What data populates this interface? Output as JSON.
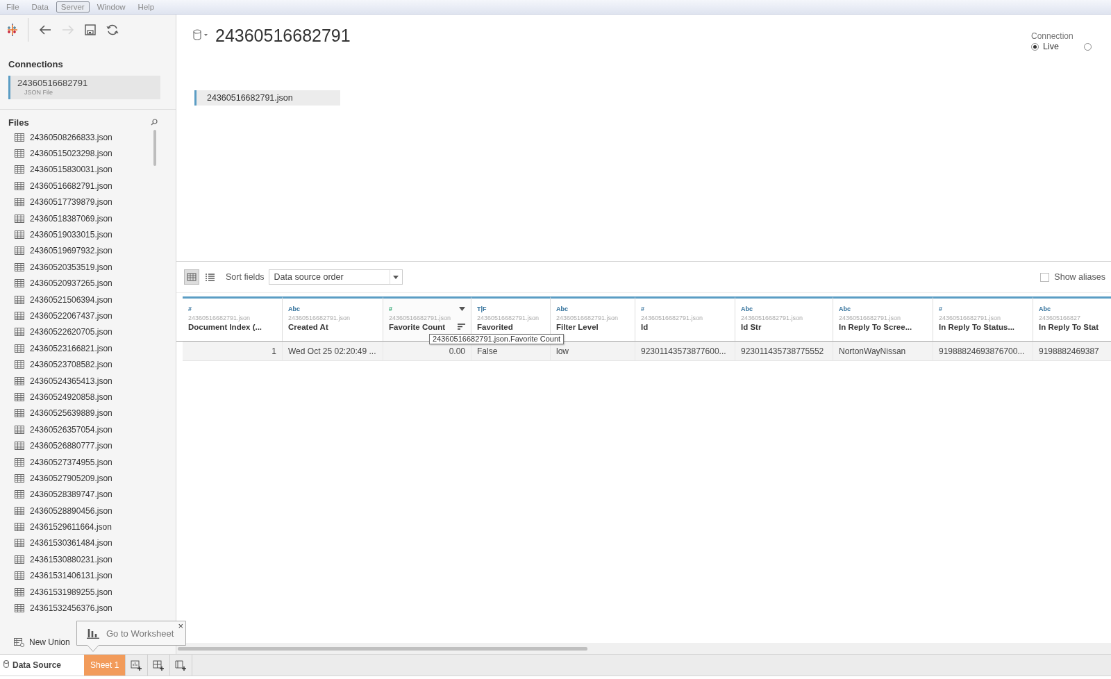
{
  "menu": [
    {
      "label": "File",
      "selected": false
    },
    {
      "label": "Data",
      "selected": false
    },
    {
      "label": "Server",
      "selected": true
    },
    {
      "label": "Window",
      "selected": false
    },
    {
      "label": "Help",
      "selected": false
    }
  ],
  "toolbar": [
    {
      "kind": "logo",
      "disabled": false
    },
    {
      "kind": "back",
      "disabled": false
    },
    {
      "kind": "forward",
      "disabled": true
    },
    {
      "kind": "save",
      "disabled": false
    },
    {
      "kind": "refresh",
      "disabled": false
    }
  ],
  "connections": {
    "title": "Connections",
    "items": [
      {
        "name": "24360516682791",
        "type": "JSON File",
        "selected": true
      }
    ]
  },
  "files": {
    "title": "Files",
    "items": [
      "24360508266833.json",
      "24360515023298.json",
      "24360515830031.json",
      "24360516682791.json",
      "24360517739879.json",
      "24360518387069.json",
      "24360519033015.json",
      "24360519697932.json",
      "24360520353519.json",
      "24360520937265.json",
      "24360521506394.json",
      "24360522067437.json",
      "24360522620705.json",
      "24360523166821.json",
      "24360523708582.json",
      "24360524365413.json",
      "24360524920858.json",
      "24360525639889.json",
      "24360526357054.json",
      "24360526880777.json",
      "24360527374955.json",
      "24360527905209.json",
      "24360528389747.json",
      "24360528890456.json",
      "24361529611664.json",
      "24361530361484.json",
      "24361530880231.json",
      "24361531406131.json",
      "24361531989255.json",
      "24361532456376.json"
    ],
    "new_union": "New Union"
  },
  "datasource": {
    "title": "24360516682791",
    "canvas_table": "24360516682791.json"
  },
  "connection": {
    "label": "Connection",
    "options": [
      {
        "label": "Live",
        "selected": true
      },
      {
        "selected": false
      }
    ]
  },
  "grid_toolbar": {
    "views": [
      {
        "kind": "grid",
        "selected": true
      },
      {
        "kind": "list",
        "selected": false
      }
    ],
    "sort_label": "Sort fields",
    "sort_value": "Data source order",
    "show_aliases": {
      "label": "Show aliases",
      "checked": false
    }
  },
  "table": {
    "columns": [
      {
        "type_label": "#",
        "kind": "dimension",
        "source": "24360516682791.json",
        "name": "Document Index (...",
        "right_aligned": true,
        "hovered": false
      },
      {
        "type_label": "Abc",
        "kind": "dimension",
        "source": "24360516682791.json",
        "name": "Created At",
        "right_aligned": false,
        "hovered": false
      },
      {
        "type_label": "#",
        "kind": "measure",
        "source": "24360516682791.json",
        "name": "Favorite Count",
        "right_aligned": true,
        "hovered": true
      },
      {
        "type_label": "T|F",
        "kind": "dimension",
        "source": "24360516682791.json",
        "name": "Favorited",
        "right_aligned": false,
        "hovered": false
      },
      {
        "type_label": "Abc",
        "kind": "dimension",
        "source": "24360516682791.json",
        "name": "Filter Level",
        "right_aligned": false,
        "hovered": false
      },
      {
        "type_label": "#",
        "kind": "dimension",
        "source": "24360516682791.json",
        "name": "Id",
        "right_aligned": false,
        "hovered": false
      },
      {
        "type_label": "Abc",
        "kind": "dimension",
        "source": "24360516682791.json",
        "name": "Id Str",
        "right_aligned": false,
        "hovered": false
      },
      {
        "type_label": "Abc",
        "kind": "dimension",
        "source": "24360516682791.json",
        "name": "In Reply To Scree...",
        "right_aligned": false,
        "hovered": false
      },
      {
        "type_label": "#",
        "kind": "dimension",
        "source": "24360516682791.json",
        "name": "In Reply To Status...",
        "right_aligned": false,
        "hovered": false
      },
      {
        "type_label": "Abc",
        "kind": "dimension",
        "source": "243605166827",
        "name": "In Reply To Stat",
        "right_aligned": false,
        "hovered": false
      }
    ],
    "rows": [
      [
        "1",
        "Wed Oct 25 02:20:49 ...",
        "0.00",
        "False",
        "low",
        "92301143573877600...",
        "923011435738775552",
        "NortonWayNissan",
        "91988824693876700...",
        "9198882469387"
      ]
    ]
  },
  "tooltip": "24360516682791.json.Favorite Count",
  "popover": {
    "label": "Go to Worksheet",
    "close": "×"
  },
  "tabs": [
    {
      "label": "Data Source",
      "kind": "datasource",
      "selected": true
    },
    {
      "label": "Sheet 1",
      "kind": "sheet",
      "selected": false
    }
  ],
  "new_sheet_buttons": [
    {
      "kind": "worksheet"
    },
    {
      "kind": "dashboard"
    },
    {
      "kind": "story"
    }
  ]
}
